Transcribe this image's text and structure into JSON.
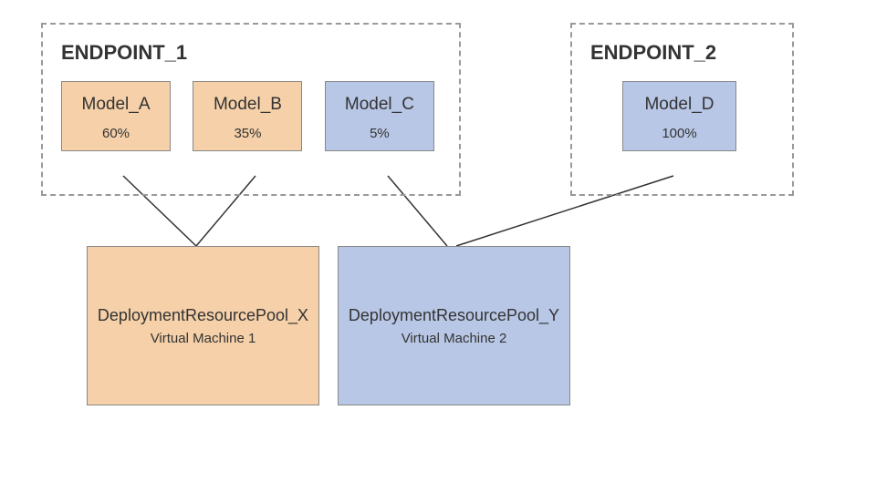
{
  "endpoints": [
    {
      "id": "endpoint1",
      "label": "ENDPOINT_1",
      "models": [
        {
          "id": "modelA",
          "name": "Model_A",
          "pct": "60%",
          "color": "orange"
        },
        {
          "id": "modelB",
          "name": "Model_B",
          "pct": "35%",
          "color": "orange"
        },
        {
          "id": "modelC",
          "name": "Model_C",
          "pct": "5%",
          "color": "blue"
        }
      ]
    },
    {
      "id": "endpoint2",
      "label": "ENDPOINT_2",
      "models": [
        {
          "id": "modelD",
          "name": "Model_D",
          "pct": "100%",
          "color": "blue"
        }
      ]
    }
  ],
  "pools": [
    {
      "id": "poolX",
      "title": "DeploymentResourcePool_X",
      "sub": "Virtual Machine 1",
      "color": "orange"
    },
    {
      "id": "poolY",
      "title": "DeploymentResourcePool_Y",
      "sub": "Virtual Machine 2",
      "color": "blue"
    }
  ]
}
